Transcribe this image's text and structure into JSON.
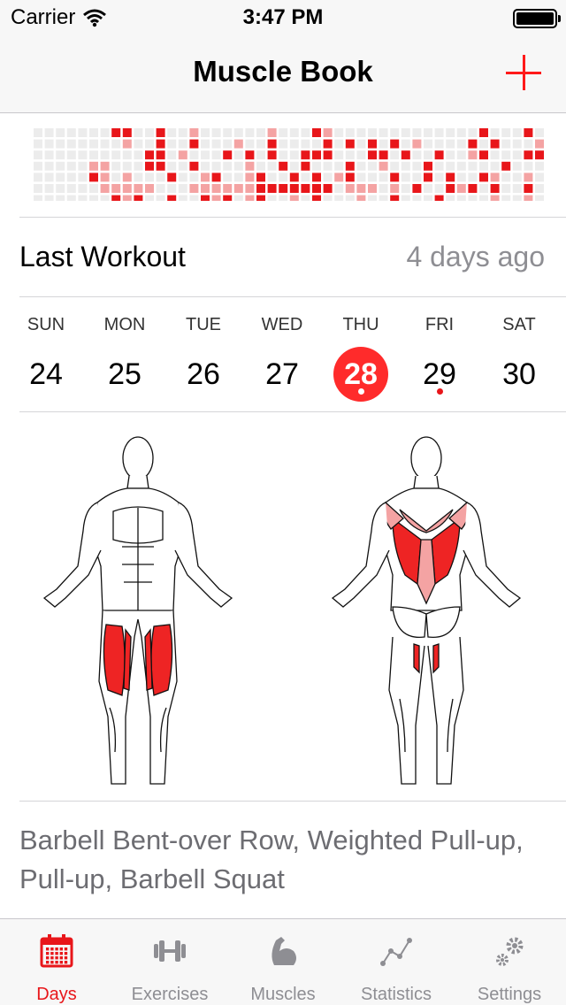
{
  "status_bar": {
    "carrier": "Carrier",
    "time": "3:47 PM"
  },
  "nav": {
    "title": "Muscle Book",
    "add_icon": "plus-icon"
  },
  "colors": {
    "accent": "#e8161a",
    "heat_high": "#e8161a",
    "heat_mid": "#f4a3a3",
    "heat_empty": "#ececec",
    "secondary_text": "#8e8e93"
  },
  "last_workout": {
    "label": "Last Workout",
    "value": "4 days ago"
  },
  "week": [
    {
      "name": "SUN",
      "num": "24",
      "selected": false,
      "dot": false
    },
    {
      "name": "MON",
      "num": "25",
      "selected": false,
      "dot": false
    },
    {
      "name": "TUE",
      "num": "26",
      "selected": false,
      "dot": false
    },
    {
      "name": "WED",
      "num": "27",
      "selected": false,
      "dot": false
    },
    {
      "name": "THU",
      "num": "28",
      "selected": true,
      "dot": true
    },
    {
      "name": "FRI",
      "num": "29",
      "selected": false,
      "dot": true
    },
    {
      "name": "SAT",
      "num": "30",
      "selected": false,
      "dot": false
    }
  ],
  "heatmap": [
    "00000001100100200000020001200000000000001000100",
    "00000000200100100020010000101010102000010100020",
    "00000000001102000101010011100011010010021000110",
    "00000220001100100002001010001002000100000010002",
    "00000120200010021002100101021000100101001200200",
    "00000022222000222222111111102220201001210100100",
    "00000001210010012102100201000200100010000200200"
  ],
  "exercises": "Barbell Bent-over Row, Weighted Pull-up, Pull-up, Barbell Squat",
  "tabs": [
    {
      "label": "Days",
      "icon": "calendar-icon",
      "active": true
    },
    {
      "label": "Exercises",
      "icon": "dumbbell-icon",
      "active": false
    },
    {
      "label": "Muscles",
      "icon": "bicep-icon",
      "active": false
    },
    {
      "label": "Statistics",
      "icon": "line-chart-icon",
      "active": false
    },
    {
      "label": "Settings",
      "icon": "gears-icon",
      "active": false
    }
  ]
}
